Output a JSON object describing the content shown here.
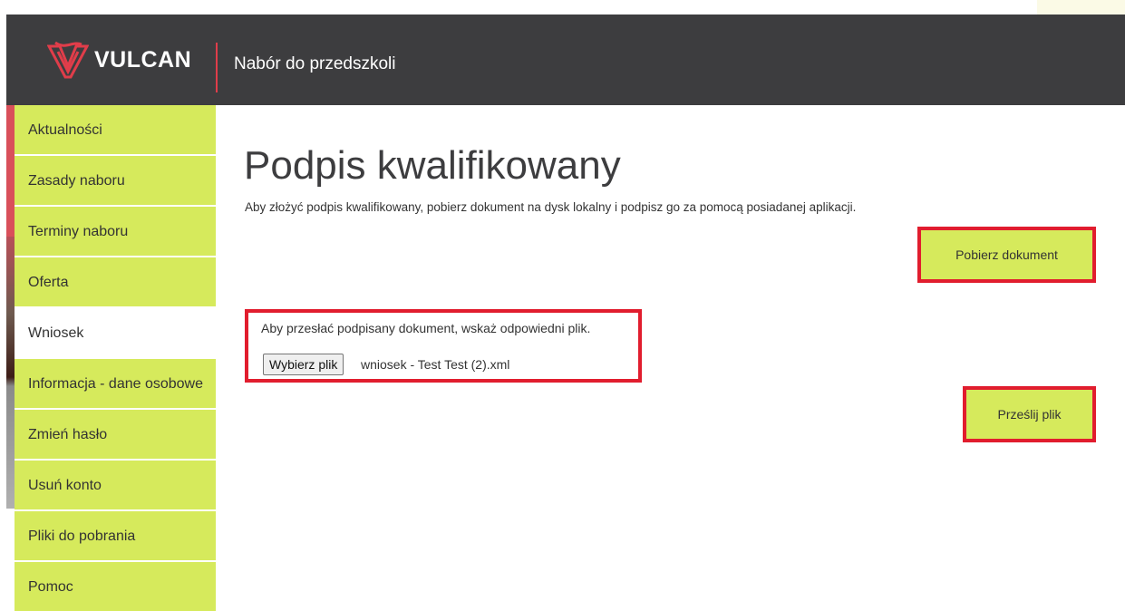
{
  "header": {
    "logo_text": "VULCAN",
    "title": "Nabór do przedszkoli"
  },
  "sidebar": {
    "items": [
      {
        "label": "Aktualności"
      },
      {
        "label": "Zasady naboru"
      },
      {
        "label": "Terminy naboru"
      },
      {
        "label": "Oferta"
      },
      {
        "label": "Wniosek",
        "active": true
      },
      {
        "label": "Informacja - dane osobowe"
      },
      {
        "label": "Zmień hasło"
      },
      {
        "label": "Usuń konto"
      },
      {
        "label": "Pliki do pobrania"
      },
      {
        "label": "Pomoc"
      }
    ]
  },
  "main": {
    "title": "Podpis kwalifikowany",
    "description": "Aby złożyć podpis kwalifikowany, pobierz dokument na dysk lokalny i podpisz go za pomocą posiadanej aplikacji.",
    "download_button": "Pobierz dokument",
    "upload": {
      "instruction": "Aby przesłać podpisany dokument, wskaż odpowiedni plik.",
      "choose_button": "Wybierz plik",
      "file_name": "wniosek - Test Test (2).xml"
    },
    "upload_button": "Prześlij plik"
  },
  "colors": {
    "header_bg": "#3d3d3f",
    "sidebar_bg": "#d6ea5c",
    "accent_red": "#e11d2e",
    "logo_red": "#e03d4a"
  },
  "icons": {
    "logo": "vulcan-logo-icon"
  }
}
